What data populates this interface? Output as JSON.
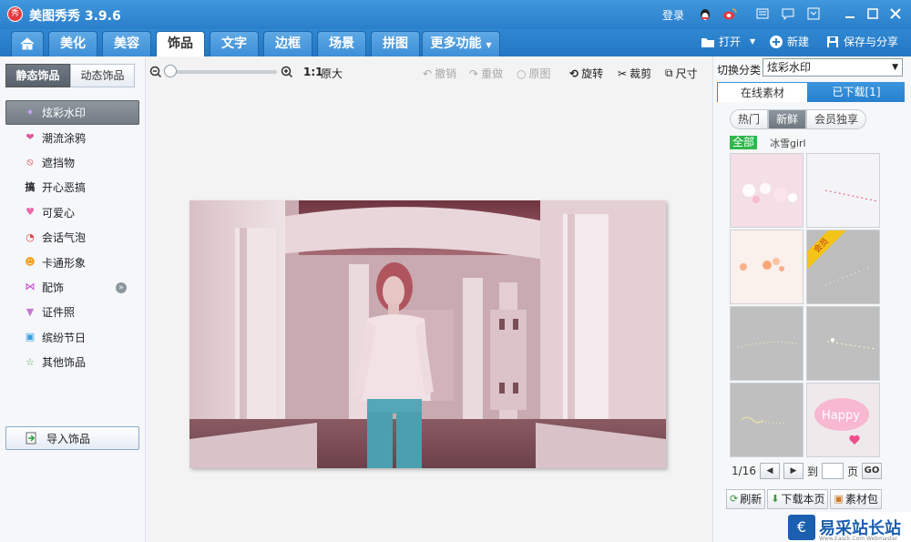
{
  "title": {
    "app": "美图秀秀 3.9.6",
    "logo_text": "秀",
    "login": "登录"
  },
  "tabs": [
    {
      "label": "美化"
    },
    {
      "label": "美容"
    },
    {
      "label": "饰品"
    },
    {
      "label": "文字"
    },
    {
      "label": "边框"
    },
    {
      "label": "场景"
    },
    {
      "label": "拼图"
    },
    {
      "label": "更多功能"
    }
  ],
  "file_actions": {
    "open": "打开",
    "new": "新建",
    "save": "保存与分享"
  },
  "left": {
    "subtab_static": "静态饰品",
    "subtab_dynamic": "动态饰品",
    "categories": [
      {
        "label": "炫彩水印",
        "icon": "sparkle-icon"
      },
      {
        "label": "潮流涂鸦",
        "icon": "lips-icon"
      },
      {
        "label": "遮挡物",
        "icon": "mask-icon"
      },
      {
        "label": "开心恶搞",
        "icon": "gao-icon"
      },
      {
        "label": "可爱心",
        "icon": "heart-icon"
      },
      {
        "label": "会话气泡",
        "icon": "bubble-icon"
      },
      {
        "label": "卡通形象",
        "icon": "cartoon-icon"
      },
      {
        "label": "配饰",
        "icon": "bow-icon"
      },
      {
        "label": "证件照",
        "icon": "shirt-icon"
      },
      {
        "label": "缤纷节日",
        "icon": "gift-icon"
      },
      {
        "label": "其他饰品",
        "icon": "star-icon"
      }
    ],
    "import": "导入饰品"
  },
  "toolbar": {
    "one_to_one": "1:1",
    "original_size": "原大",
    "undo": "撤销",
    "redo": "重做",
    "original_image": "原图",
    "rotate": "旋转",
    "crop": "裁剪",
    "size": "尺寸"
  },
  "right": {
    "switch_label": "切换分类",
    "selected_category": "炫彩水印",
    "tab_online": "在线素材",
    "tab_downloaded": "已下载[1]",
    "filters": [
      "热门",
      "新鲜",
      "会员独享"
    ],
    "filter_all": "全部",
    "filter_sub": "冰雪girl",
    "vip_ribbon": "会员",
    "happy_text": "Happy",
    "page_indicator": "1/16",
    "goto_label": "到",
    "page_label": "页",
    "go": "GO",
    "refresh": "刷新",
    "download_page": "下载本页",
    "package": "素材包"
  },
  "watermark": {
    "icon": "€",
    "text": "易采站长站",
    "sub": "Www.Easck.Com Webmaster"
  }
}
